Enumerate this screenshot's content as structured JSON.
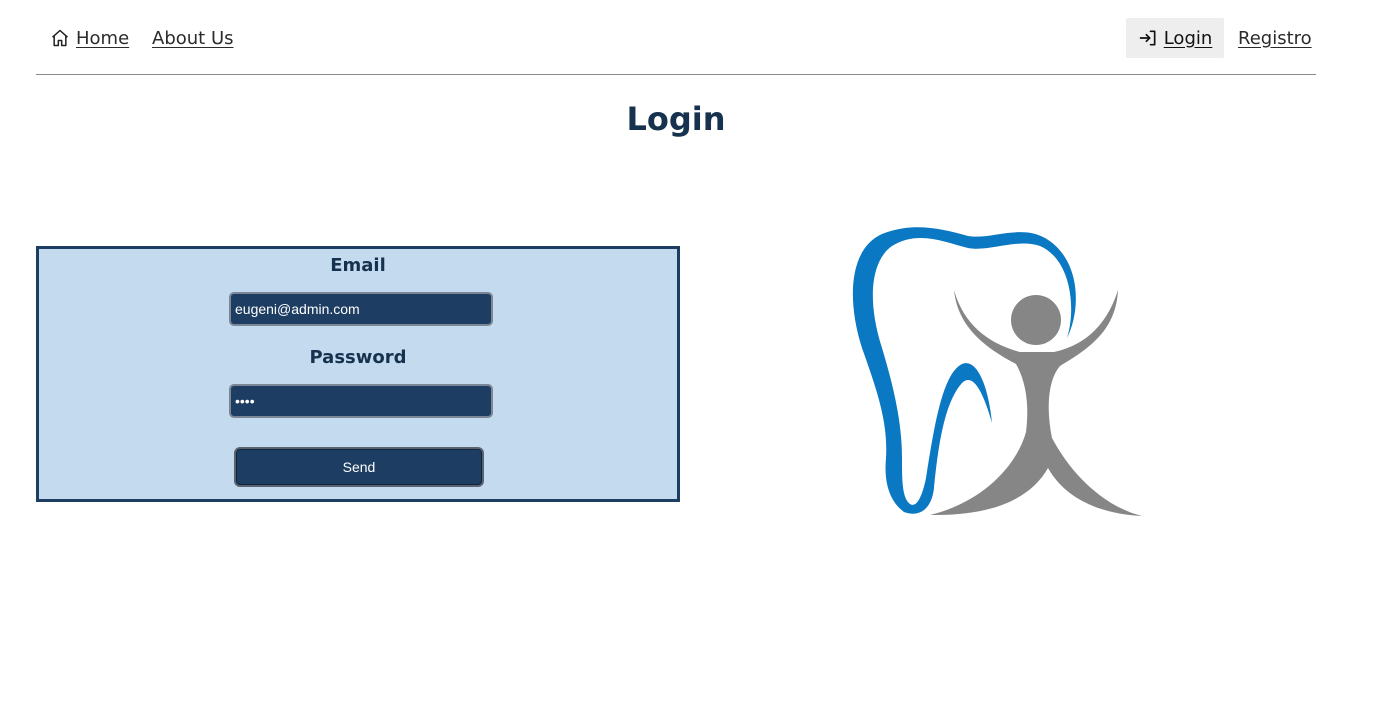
{
  "nav": {
    "home_label": "Home",
    "about_label": "About Us",
    "login_label": "Login",
    "register_label": "Registro"
  },
  "page": {
    "title": "Login"
  },
  "form": {
    "email_label": "Email",
    "email_value": "eugeni@admin.com",
    "password_label": "Password",
    "password_value": "••••",
    "send_label": "Send"
  },
  "icons": {
    "home": "home-icon",
    "login": "login-icon",
    "logo": "dental-logo"
  },
  "colors": {
    "primary_dark": "#1e3d62",
    "title": "#16324f",
    "form_background": "#c4daee",
    "logo_blue": "#0a78c2",
    "logo_gray": "#868686"
  }
}
